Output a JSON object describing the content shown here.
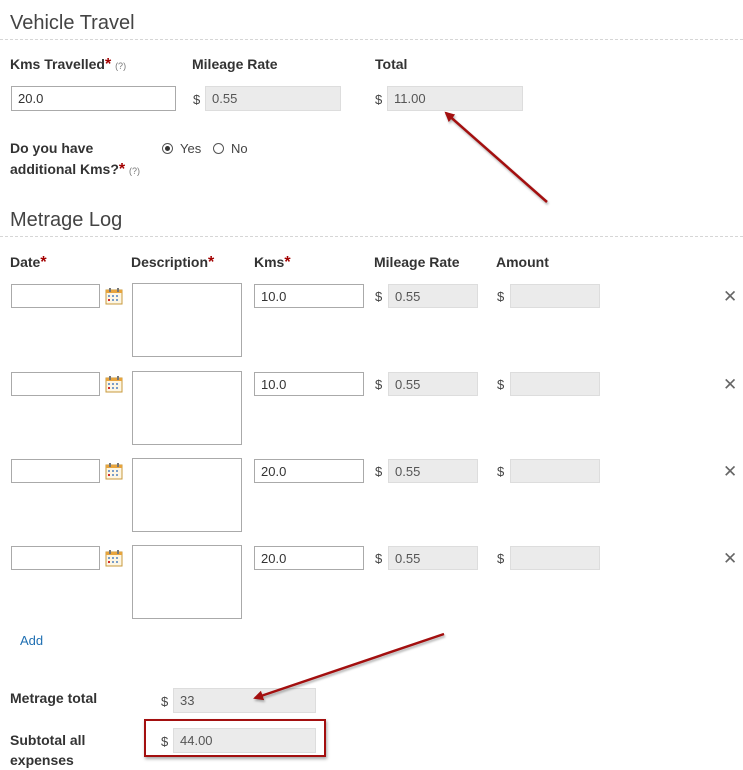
{
  "vehicle_travel": {
    "title": "Vehicle Travel",
    "kms_label": "Kms Travelled",
    "kms_value": "20.0",
    "rate_label": "Mileage Rate",
    "rate_value": "0.55",
    "total_label": "Total",
    "total_value": "11.00",
    "currency": "$",
    "required_mark": "*",
    "help_text": "(?)",
    "additional_label_line1": "Do you have",
    "additional_label_line2": "additional Kms?",
    "options": {
      "yes": "Yes",
      "no": "No",
      "selected": "Yes"
    }
  },
  "metrage_log": {
    "title": "Metrage Log",
    "columns": {
      "date": "Date",
      "description": "Description",
      "kms": "Kms",
      "rate": "Mileage Rate",
      "amount": "Amount"
    },
    "rows": [
      {
        "date": "",
        "description": "",
        "kms": "10.0",
        "rate": "0.55",
        "amount": ""
      },
      {
        "date": "",
        "description": "",
        "kms": "10.0",
        "rate": "0.55",
        "amount": ""
      },
      {
        "date": "",
        "description": "",
        "kms": "20.0",
        "rate": "0.55",
        "amount": ""
      },
      {
        "date": "",
        "description": "",
        "kms": "20.0",
        "rate": "0.55",
        "amount": ""
      }
    ],
    "remove_icon": "✕",
    "add_label": "Add"
  },
  "totals": {
    "metrage_total_label": "Metrage total",
    "metrage_total_value": "33",
    "subtotal_label_line1": "Subtotal all",
    "subtotal_label_line2": "expenses",
    "subtotal_value": "44.00"
  },
  "annotation": {
    "arrow_color": "#a30f0f",
    "highlight_color": "#a30f0f"
  }
}
